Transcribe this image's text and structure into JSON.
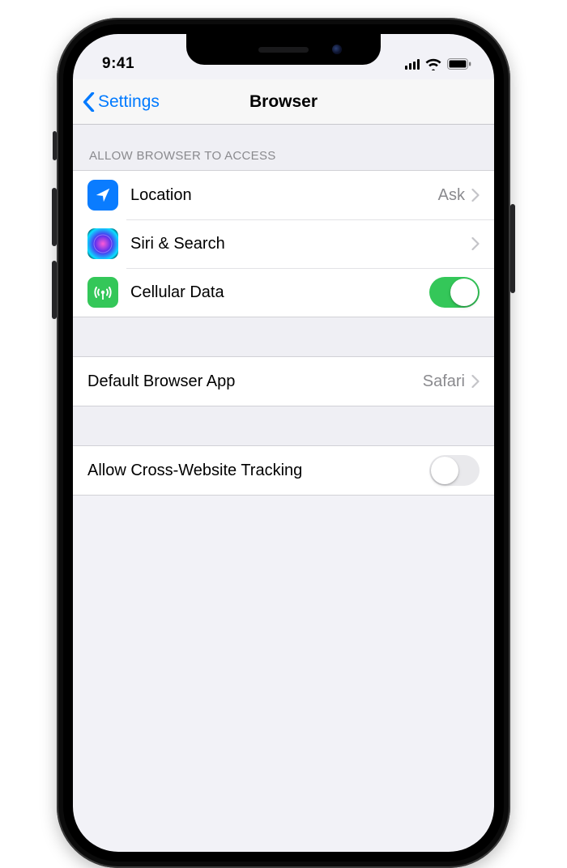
{
  "status": {
    "time": "9:41"
  },
  "nav": {
    "back": "Settings",
    "title": "Browser"
  },
  "section_access_header": "ALLOW BROWSER TO ACCESS",
  "rows": {
    "location": {
      "label": "Location",
      "value": "Ask"
    },
    "siri": {
      "label": "Siri & Search"
    },
    "cellular": {
      "label": "Cellular Data",
      "toggle": true
    },
    "default_browser": {
      "label": "Default Browser App",
      "value": "Safari"
    },
    "cross_tracking": {
      "label": "Allow Cross-Website Tracking",
      "toggle": false
    }
  },
  "colors": {
    "accent": "#007aff",
    "toggle_on": "#34c759",
    "secondary_text": "#8a8a8e"
  }
}
